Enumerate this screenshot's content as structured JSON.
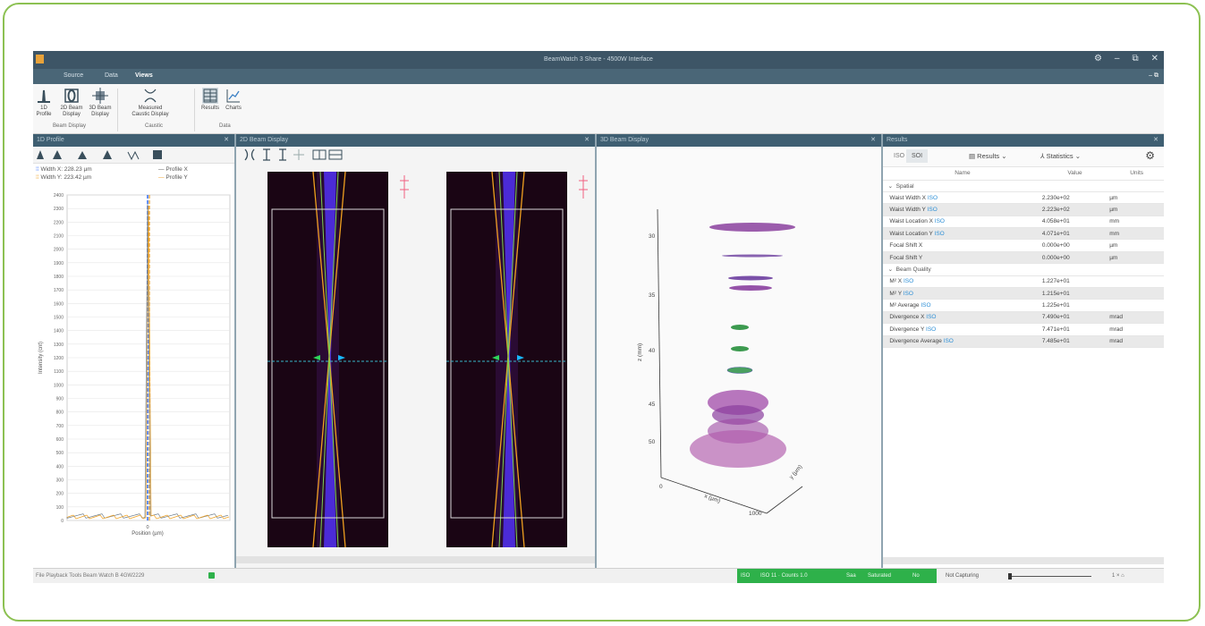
{
  "app": {
    "title": "BeamWatch 3 Share - 4500W Interface",
    "menu": [
      "Source",
      "Data",
      "Views"
    ],
    "window_buttons": [
      "⚙",
      "–",
      "⧉",
      "✕"
    ]
  },
  "ribbon": {
    "buttons": [
      {
        "label": "1D Profile",
        "icon": "profile-icon"
      },
      {
        "label": "2D Beam Display",
        "icon": "beam-2d-icon"
      },
      {
        "label": "3D Beam Display",
        "icon": "beam-3d-icon"
      },
      {
        "label": "Measured Caustic Display",
        "icon": "caustic-icon"
      },
      {
        "label": "Results",
        "icon": "results-icon"
      },
      {
        "label": "Charts",
        "icon": "chart-icon"
      }
    ],
    "groups": [
      "Beam Display",
      "Caustic",
      "Data"
    ]
  },
  "panels": {
    "profile": {
      "title": "1D Profile",
      "legend": [
        {
          "label": "Width X: 228.23 µm",
          "color": "#f0a020"
        },
        {
          "label": "Width Y: 223.42 µm",
          "color": "#f0a020"
        },
        {
          "label": "Profile X",
          "color": "#6c7c8a"
        },
        {
          "label": "Profile Y",
          "color": "#f0a020"
        }
      ],
      "ylabel": "Intensity (cnt)",
      "xlabel": "Position (µm)",
      "xtick": "0",
      "yticks": [
        "2400",
        "2300",
        "2200",
        "2100",
        "2000",
        "1900",
        "1800",
        "1700",
        "1600",
        "1500",
        "1400",
        "1300",
        "1200",
        "1100",
        "1000",
        "900",
        "800",
        "700",
        "600",
        "500",
        "400",
        "300",
        "200",
        "100",
        "0"
      ]
    },
    "beam2d": {
      "title": "2D Beam Display"
    },
    "beam3d": {
      "title": "3D Beam Display",
      "zticks": [
        "30",
        "35",
        "40",
        "45",
        "50"
      ],
      "zlabel": "z (mm)",
      "xlabel": "x (µm)",
      "ylabel": "y (µm)",
      "xtick": "1000",
      "origin": "0"
    },
    "results": {
      "title": "Results",
      "tabs": [
        "ISO",
        "SOI"
      ],
      "dropdowns": [
        "Results",
        "Statistics"
      ],
      "columns": [
        "Name",
        "Value",
        "Units"
      ],
      "sections": [
        {
          "name": "Spatial",
          "rows": [
            {
              "name": "Waist Width X",
              "tag": "ISO",
              "value": "2.230e+02",
              "unit": "µm"
            },
            {
              "name": "Waist Width Y",
              "tag": "ISO",
              "value": "2.223e+02",
              "unit": "µm"
            },
            {
              "name": "Waist Location X",
              "tag": "ISO",
              "value": "4.058e+01",
              "unit": "mm"
            },
            {
              "name": "Waist Location Y",
              "tag": "ISO",
              "value": "4.071e+01",
              "unit": "mm"
            },
            {
              "name": "Focal Shift X",
              "tag": "",
              "value": "0.000e+00",
              "unit": "µm"
            },
            {
              "name": "Focal Shift Y",
              "tag": "",
              "value": "0.000e+00",
              "unit": "µm"
            }
          ]
        },
        {
          "name": "Beam Quality",
          "rows": [
            {
              "name": "M² X",
              "tag": "ISO",
              "value": "1.227e+01",
              "unit": ""
            },
            {
              "name": "M² Y",
              "tag": "ISO",
              "value": "1.215e+01",
              "unit": ""
            },
            {
              "name": "M² Average",
              "tag": "ISO",
              "value": "1.225e+01",
              "unit": ""
            },
            {
              "name": "Divergence X",
              "tag": "ISO",
              "value": "7.490e+01",
              "unit": "mrad"
            },
            {
              "name": "Divergence Y",
              "tag": "ISO",
              "value": "7.471e+01",
              "unit": "mrad"
            },
            {
              "name": "Divergence Average",
              "tag": "ISO",
              "value": "7.485e+01",
              "unit": "mrad"
            }
          ]
        }
      ]
    }
  },
  "status": {
    "left": "File Playback Tools Beam Watch B 4GW2229",
    "segments": [
      "ISO",
      "ISO 11 · Counts 1.0",
      "Saa",
      "Saturated",
      "No"
    ],
    "right": "Not Capturing",
    "zoom": "1 × ⌂"
  },
  "colors": {
    "accent_green": "#2eb14a",
    "beam_blue": "#3b74ff",
    "beam_orange": "#f0a020",
    "ellipse_purple": "#8a3f9e"
  }
}
